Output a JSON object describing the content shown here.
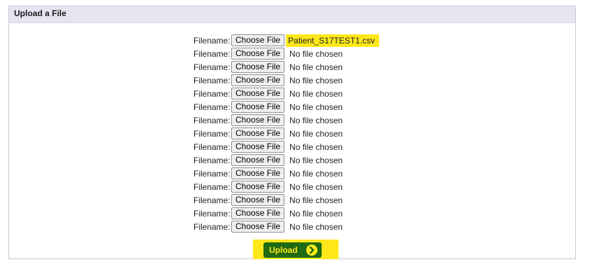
{
  "panel": {
    "title": "Upload a File"
  },
  "files": [
    {
      "label": "Filename:",
      "button": "Choose File",
      "status": "Patient_S17TEST1.csv",
      "highlighted": true
    },
    {
      "label": "Filename:",
      "button": "Choose File",
      "status": "No file chosen"
    },
    {
      "label": "Filename:",
      "button": "Choose File",
      "status": "No file chosen"
    },
    {
      "label": "Filename:",
      "button": "Choose File",
      "status": "No file chosen"
    },
    {
      "label": "Filename:",
      "button": "Choose File",
      "status": "No file chosen"
    },
    {
      "label": "Filename:",
      "button": "Choose File",
      "status": "No file chosen"
    },
    {
      "label": "Filename:",
      "button": "Choose File",
      "status": "No file chosen"
    },
    {
      "label": "Filename:",
      "button": "Choose File",
      "status": "No file chosen"
    },
    {
      "label": "Filename:",
      "button": "Choose File",
      "status": "No file chosen"
    },
    {
      "label": "Filename:",
      "button": "Choose File",
      "status": "No file chosen"
    },
    {
      "label": "Filename:",
      "button": "Choose File",
      "status": "No file chosen"
    },
    {
      "label": "Filename:",
      "button": "Choose File",
      "status": "No file chosen"
    },
    {
      "label": "Filename:",
      "button": "Choose File",
      "status": "No file chosen"
    },
    {
      "label": "Filename:",
      "button": "Choose File",
      "status": "No file chosen"
    },
    {
      "label": "Filename:",
      "button": "Choose File",
      "status": "No file chosen"
    }
  ],
  "upload": {
    "label": "Upload",
    "icon": "arrow-right-circle-icon"
  },
  "colors": {
    "highlight": "#ffe81a",
    "button_green": "#1f6a12",
    "header_bg": "#e6e6f2"
  }
}
